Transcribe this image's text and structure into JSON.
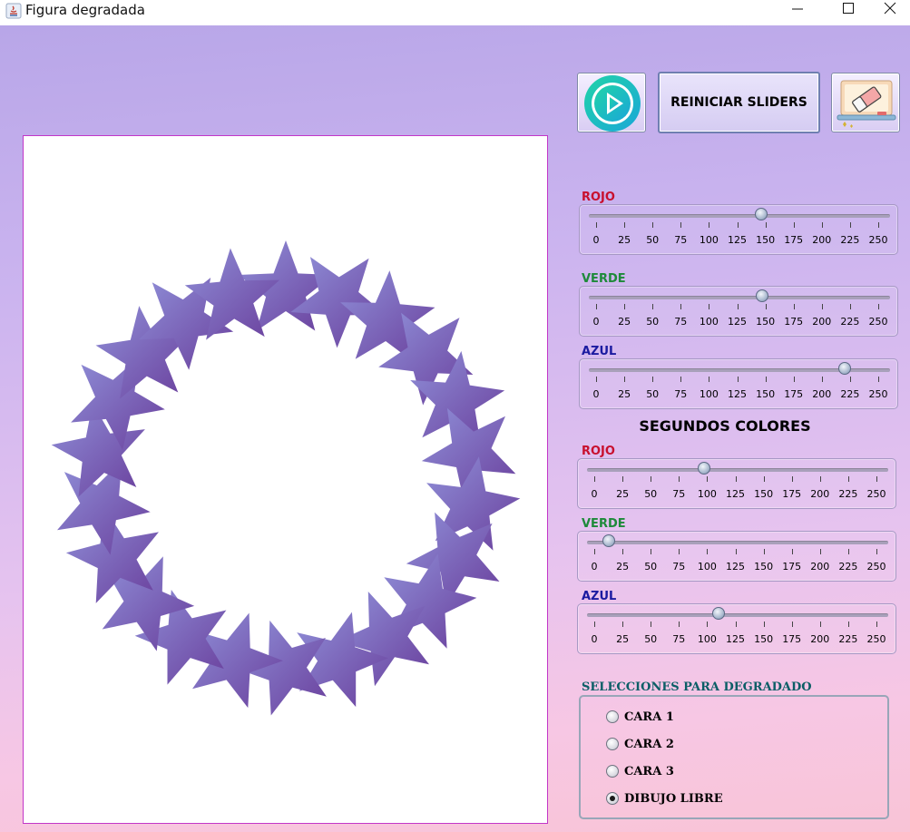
{
  "window": {
    "title": "Figura degradada"
  },
  "toolbar": {
    "play_icon": "play-circle-icon",
    "reset_label": "REINICIAR SLIDERS",
    "erase_icon": "eraser-icon"
  },
  "tick_values": [
    "0",
    "25",
    "50",
    "75",
    "100",
    "125",
    "150",
    "175",
    "200",
    "225",
    "250"
  ],
  "first_colors": [
    {
      "label": "ROJO",
      "color": "#c8102e",
      "value": 146
    },
    {
      "label": "VERDE",
      "color": "#1e8a3a",
      "value": 147
    },
    {
      "label": "AZUL",
      "color": "#1a1aa0",
      "value": 220
    }
  ],
  "second_title": "SEGUNDOS COLORES",
  "second_colors": [
    {
      "label": "ROJO",
      "color": "#c8102e",
      "value": 97
    },
    {
      "label": "VERDE",
      "color": "#1e8a3a",
      "value": 13
    },
    {
      "label": "AZUL",
      "color": "#1a1aa0",
      "value": 110
    }
  ],
  "selection": {
    "title": "SELECCIONES PARA DEGRADADO",
    "options": [
      {
        "label": "CARA 1",
        "checked": false
      },
      {
        "label": "CARA 2",
        "checked": false
      },
      {
        "label": "CARA 3",
        "checked": false
      },
      {
        "label": "DIBUJO LIBRE",
        "checked": true
      }
    ]
  },
  "drawing": {
    "star_count": 22,
    "gradient_colors": [
      "#8f8fd8",
      "#6a3f9c"
    ]
  }
}
